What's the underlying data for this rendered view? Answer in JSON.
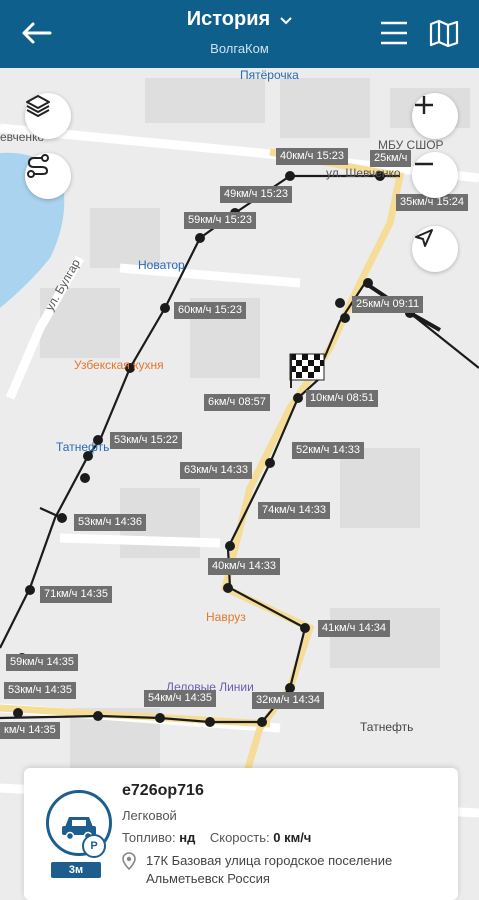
{
  "header": {
    "title": "История",
    "subtitle": "ВолгаКом",
    "colors": {
      "bar": "#0f5f8c"
    }
  },
  "map": {
    "pois": [
      {
        "name": "Пятёрочка",
        "color": "#2a6ab8"
      },
      {
        "name": "МБУ СШОР",
        "color": "#555555"
      },
      {
        "name": "Новатор",
        "color": "#2a6ab8"
      },
      {
        "name": "Узбекская кухня",
        "color": "#e2782a"
      },
      {
        "name": "Татнефть",
        "color": "#2a6ab8"
      },
      {
        "name": "Навруз",
        "color": "#e2782a"
      },
      {
        "name": "Деловые Линии",
        "color": "#6a5db5"
      },
      {
        "name": "Татнефть",
        "color": "#444444"
      },
      {
        "name": "ул. Шевченко",
        "color": "#555555"
      },
      {
        "name": "ул. Булгар",
        "color": "#555555"
      },
      {
        "name": "евченко",
        "color": "#555555"
      }
    ],
    "speed_labels": [
      "40км/ч 15:23",
      "25км/ч",
      "49км/ч 15:23",
      "35км/ч 15:24",
      "59км/ч 15:23",
      "60км/ч 15:23",
      "25км/ч 09:11",
      "6км/ч 08:57",
      "10км/ч 08:51",
      "53км/ч 15:22",
      "52км/ч 14:33",
      "63км/ч 14:33",
      "53км/ч 14:36",
      "74км/ч 14:33",
      "40км/ч 14:33",
      "71км/ч 14:35",
      "41км/ч 14:34",
      "59км/ч 14:35",
      "53км/ч 14:35",
      "54км/ч 14:35",
      "32км/ч 14:34",
      "км/ч 14:35"
    ],
    "controls": {
      "layers_icon": "layers-icon",
      "route_icon": "route-icon",
      "zoom_in_icon": "plus-icon",
      "zoom_out_icon": "minus-icon",
      "locate_icon": "navigation-arrow-icon"
    }
  },
  "vehicle": {
    "plate": "е726ор716",
    "type": "Легковой",
    "fuel_label": "Топливо:",
    "fuel_value": "нд",
    "speed_label": "Скорость:",
    "speed_value": "0 км/ч",
    "address": "17К Базовая улица городское поселение Альметьевск Россия",
    "age": "3м",
    "parking_badge": "P",
    "accent": "#1e5e8f"
  }
}
